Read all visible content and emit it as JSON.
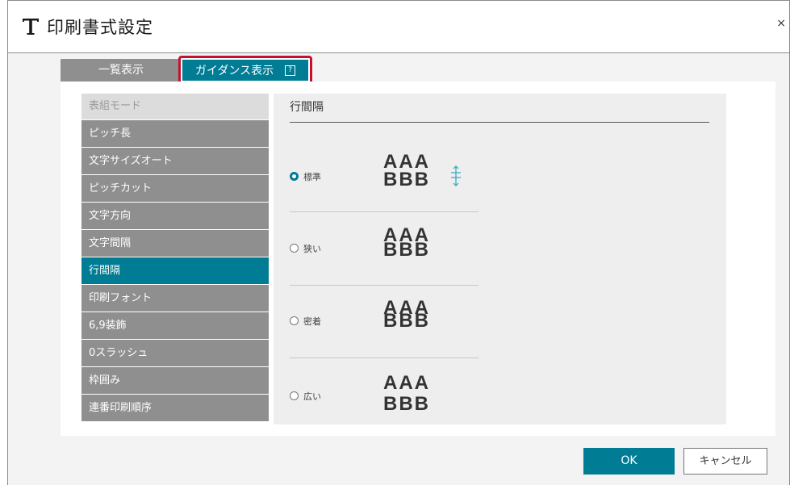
{
  "window": {
    "title": "印刷書式設定",
    "close_glyph": "×",
    "title_icon": "letter-t-icon"
  },
  "tabs": [
    {
      "label": "一覧表示",
      "selected": false
    },
    {
      "label": "ガイダンス表示",
      "selected": true,
      "help_glyph": "?"
    }
  ],
  "sidebar": {
    "header": "表組モード",
    "items": [
      {
        "label": "ピッチ長"
      },
      {
        "label": "文字サイズオート"
      },
      {
        "label": "ピッチカット"
      },
      {
        "label": "文字方向"
      },
      {
        "label": "文字間隔"
      },
      {
        "label": "行間隔",
        "active": true
      },
      {
        "label": "印刷フォント"
      },
      {
        "label": "6,9装飾"
      },
      {
        "label": "0スラッシュ"
      },
      {
        "label": "枠囲み"
      },
      {
        "label": "連番印刷順序"
      }
    ]
  },
  "content": {
    "title": "行間隔",
    "options": [
      {
        "label": "標準",
        "checked": true,
        "line1": "AAA",
        "line2": "BBB"
      },
      {
        "label": "狭い",
        "checked": false,
        "line1": "AAA",
        "line2": "BBB"
      },
      {
        "label": "密着",
        "checked": false,
        "line1": "AAA",
        "line2": "BBB"
      },
      {
        "label": "広い",
        "checked": false,
        "line1": "AAA",
        "line2": "BBB"
      }
    ]
  },
  "buttons": {
    "ok": "OK",
    "cancel": "キャンセル"
  },
  "colors": {
    "accent": "#007c94",
    "highlight": "#c8102e",
    "inactive": "#8f8f8f"
  }
}
